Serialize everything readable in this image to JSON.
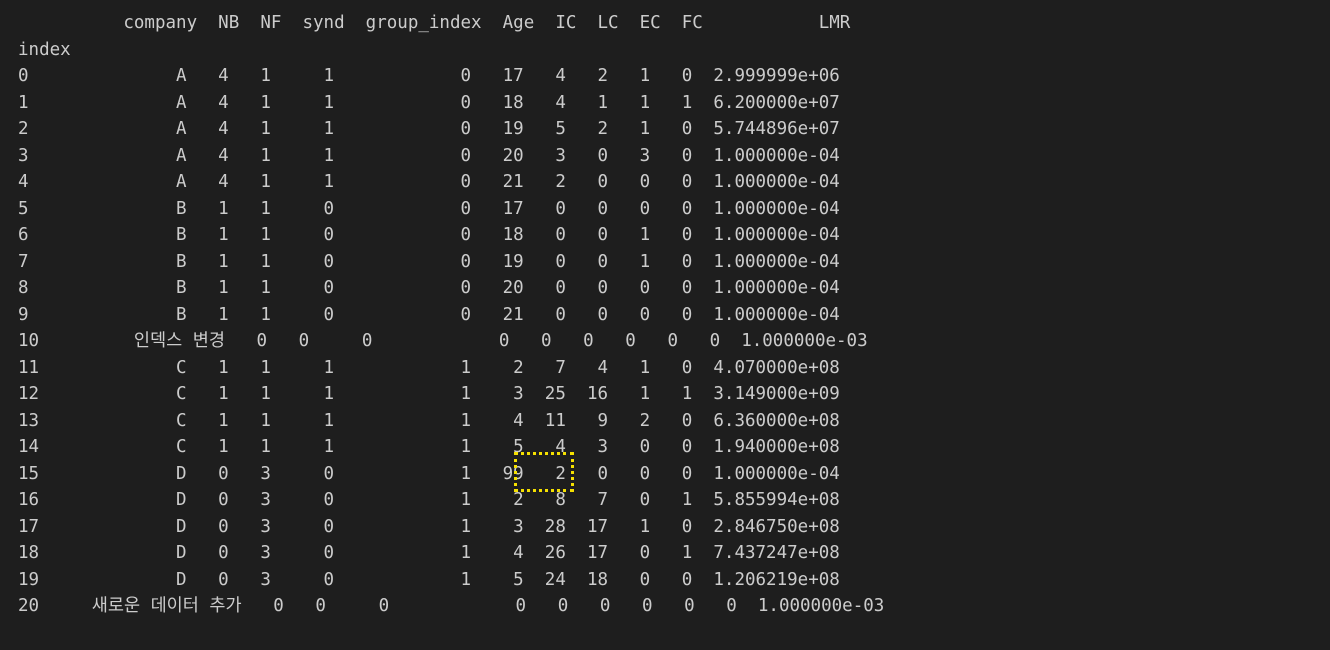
{
  "terminal": {
    "lines": [
      "          company  NB  NF  synd  group_index  Age  IC  LC  EC  FC           LMR",
      "index",
      "0              A   4   1     1            0   17   4   2   1   0  2.999999e+06",
      "1              A   4   1     1            0   18   4   1   1   1  6.200000e+07",
      "2              A   4   1     1            0   19   5   2   1   0  5.744896e+07",
      "3              A   4   1     1            0   20   3   0   3   0  1.000000e-04",
      "4              A   4   1     1            0   21   2   0   0   0  1.000000e-04",
      "5              B   1   1     0            0   17   0   0   0   0  1.000000e-04",
      "6              B   1   1     0            0   18   0   0   1   0  1.000000e-04",
      "7              B   1   1     0            0   19   0   0   1   0  1.000000e-04",
      "8              B   1   1     0            0   20   0   0   0   0  1.000000e-04",
      "9              B   1   1     0            0   21   0   0   0   0  1.000000e-04",
      "10         인덱스 변경   0   0     0            0   0   0   0   0   0  1.000000e-03",
      "11             C   1   1     1            1    2   7   4   1   0  4.070000e+08",
      "12             C   1   1     1            1    3  25  16   1   1  3.149000e+09",
      "13             C   1   1     1            1    4  11   9   2   0  6.360000e+08",
      "14             C   1   1     1            1    5   4   3   0   0  1.940000e+08",
      "15             D   0   3     0            1   99   2   0   0   0  1.000000e-04",
      "16             D   0   3     0            1    2   8   7   0   1  5.855994e+08",
      "17             D   0   3     0            1    3  28  17   1   0  2.846750e+08",
      "18             D   0   3     0            1    4  26  17   0   1  7.437247e+08",
      "19             D   0   3     0            1    5  24  18   0   0  1.206219e+08",
      "20     새로운 데이터 추가   0   0     0            0   0   0   0   0   0  1.000000e-03"
    ]
  },
  "colors": {
    "background": "#1e1e1e",
    "text": "#cccccc",
    "highlight": "#f5e000"
  }
}
